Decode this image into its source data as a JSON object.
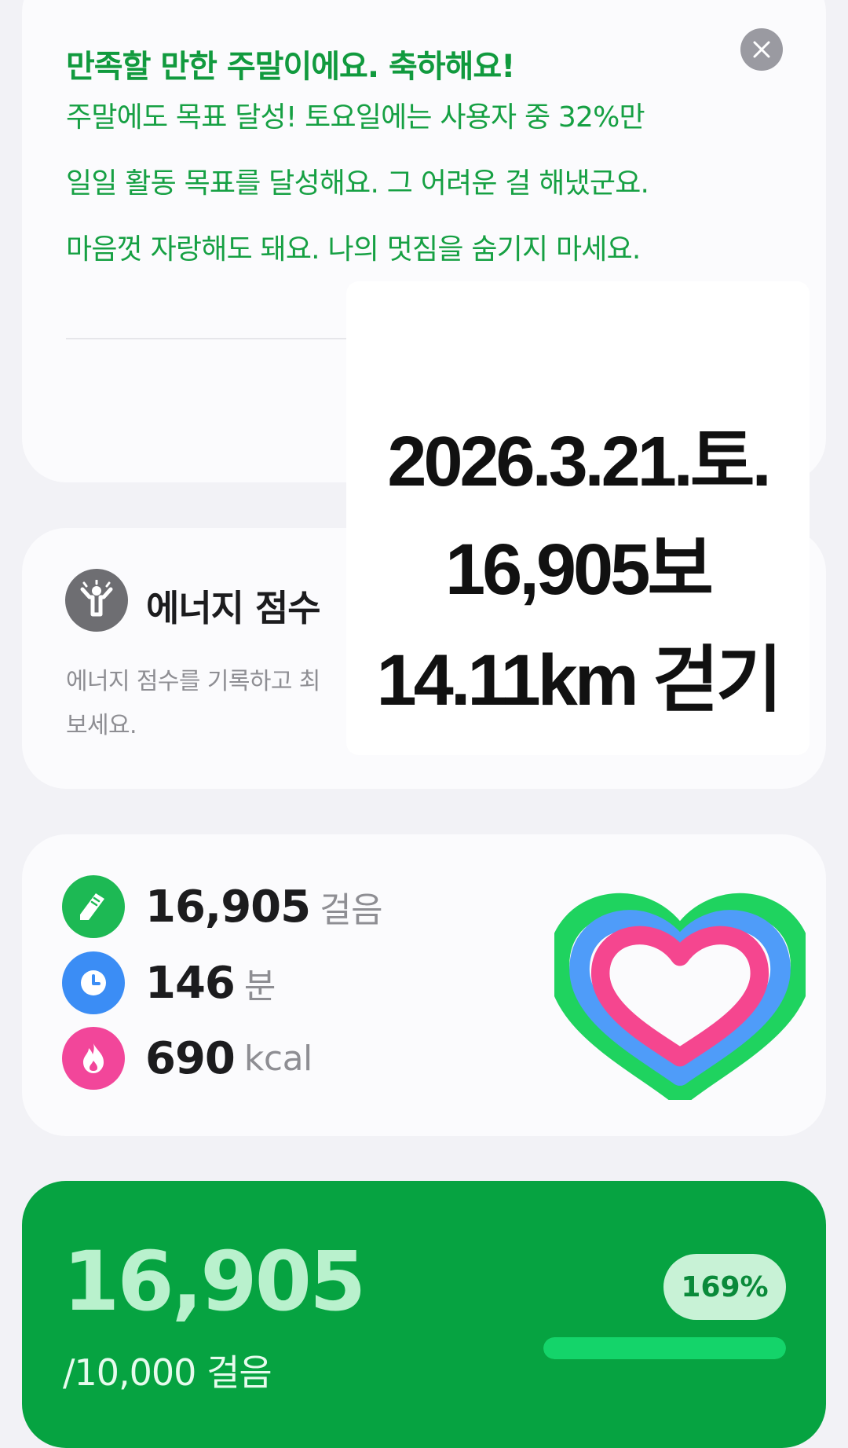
{
  "congrats": {
    "title": "만족할 만한 주말이에요. 축하해요!",
    "lines": [
      "주말에도 목표 달성! 토요일에는 사용자 중 32%만",
      "일일 활동 목표를 달성해요. 그 어려운 걸 해냈군요.",
      "마음껏 자랑해도 돼요. 나의 멋짐을 숨기지 마세요."
    ],
    "close_icon": "close-icon"
  },
  "energy": {
    "title": "에너지 점수",
    "description_lines": [
      "에너지 점수를 기록하고 최",
      "보세요."
    ],
    "icon": "energy-person-icon"
  },
  "activity": {
    "steps": {
      "value": "16,905",
      "unit": "걸음",
      "icon": "shoe-icon",
      "color": "#1db954"
    },
    "minutes": {
      "value": "146",
      "unit": "분",
      "icon": "clock-icon",
      "color": "#3b8df5"
    },
    "calories": {
      "value": "690",
      "unit": "kcal",
      "icon": "flame-icon",
      "color": "#f2469a"
    },
    "rings": {
      "steps_color": "#1fd35f",
      "minutes_color": "#4f9cf9",
      "calories_color": "#f5468f"
    }
  },
  "goal": {
    "steps": "16,905",
    "target": "/10,000 걸음",
    "percent_label": "169%",
    "progress_fraction": 1.0,
    "background_color": "#06a341"
  },
  "overlay": {
    "date": "2026.3.21.토.",
    "steps": "16,905보",
    "distance": "14.11km 걷기"
  }
}
